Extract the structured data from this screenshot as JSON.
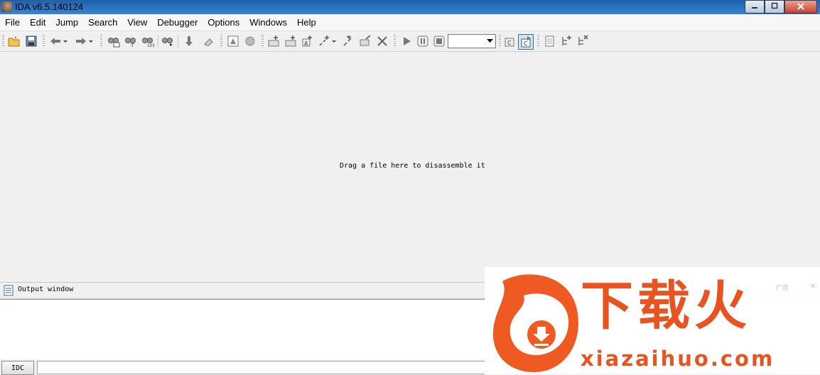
{
  "window": {
    "title": "IDA v6.5.140124",
    "controls": {
      "minimize": "—",
      "maximize": "▢",
      "close": "✕"
    }
  },
  "menu": [
    "File",
    "Edit",
    "Jump",
    "Search",
    "View",
    "Debugger",
    "Options",
    "Windows",
    "Help"
  ],
  "main": {
    "hint": "Drag a file here to disassemble it"
  },
  "output": {
    "title": "Output window",
    "content": ""
  },
  "command": {
    "button_label": "IDC",
    "value": ""
  },
  "watermark": {
    "logo_text": "下载火",
    "domain": "xiazaihuo.com",
    "ad_label": "广告",
    "close": "✕"
  },
  "colors": {
    "titlebar": "#2a71c0",
    "watermark_brand": "#e8531f",
    "background": "#f0f0f0"
  }
}
